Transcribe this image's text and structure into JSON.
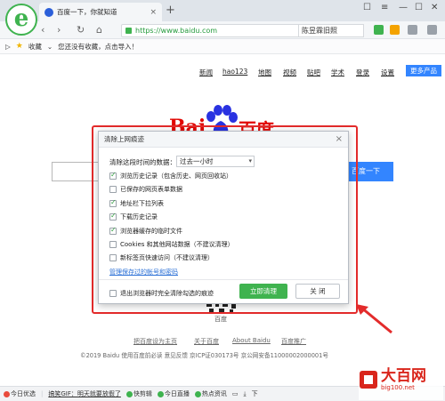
{
  "browser": {
    "logo_letter": "e",
    "tab_title": "百度一下，你就知道",
    "tab_close": "×",
    "new_tab": "+",
    "address_url": "https://www.baidu.com",
    "search_box_text": "陈昱霖旧照",
    "bookmarks": {
      "favorites_label": "收藏",
      "hint": "您还没有收藏，点击导入！"
    }
  },
  "page": {
    "nav_links": [
      "新闻",
      "hao123",
      "地图",
      "视频",
      "贴吧",
      "学术",
      "登录",
      "设置"
    ],
    "more_products": "更多产品",
    "logo_bai": "Bai",
    "logo_du": "百度",
    "search_button": "百度一下",
    "qr_label": "百度",
    "footer_links": [
      "把百度设为主页",
      "关于百度",
      "About Baidu",
      "百度推广"
    ],
    "footer_legal": "©2019 Baidu 使用百度前必读 意见反馈 京ICP证030173号   京公网安备11000002000001号"
  },
  "dialog": {
    "title": "清除上网痕迹",
    "close_label": "×",
    "range_label": "清除这段时间的数据：",
    "range_value": "过去一小时",
    "options": [
      {
        "label": "浏览历史记录（包含历史、网页回收站）",
        "checked": true
      },
      {
        "label": "已保存的网页表单数据",
        "checked": false
      },
      {
        "label": "地址栏下拉列表",
        "checked": true
      },
      {
        "label": "下载历史记录",
        "checked": true
      },
      {
        "label": "浏览器缓存的临时文件",
        "checked": true
      },
      {
        "label": "Cookies 和其他网站数据（不建议清理）",
        "checked": false
      },
      {
        "label": "新标签页快速访问（不建议清理）",
        "checked": false
      }
    ],
    "manage_link": "管理保存过的帐号和密码",
    "exit_clear_label": "退出浏览器时完全清除勾选的痕迹",
    "clear_button": "立即清理",
    "close_button": "关 闭"
  },
  "statusbar": {
    "items": [
      "今日优选",
      "搞笑GIF：明天就要放假了",
      "快剪辑",
      "今日直播",
      "热点资讯"
    ],
    "tail": "下"
  },
  "watermark": {
    "title": "大百网",
    "sub": "big100.net"
  },
  "colors": {
    "accent_green": "#3fb34f",
    "baidu_blue": "#3385ff",
    "baidu_red": "#e10602",
    "highlight_red": "#e32b2b"
  }
}
